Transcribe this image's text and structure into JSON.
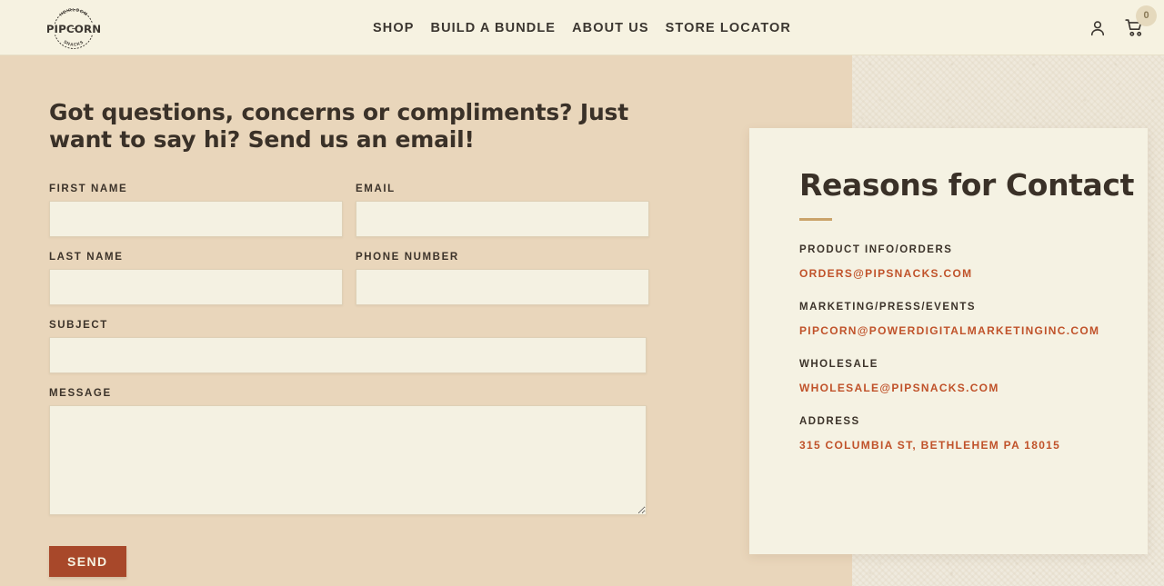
{
  "header": {
    "logo": {
      "brand": "PIPCORN",
      "arc_top": "HEIRLOOM",
      "arc_bottom": "SNACKS",
      "alt": "Pipcorn Heirloom Snacks"
    },
    "nav": [
      {
        "label": "SHOP",
        "name": "nav-shop"
      },
      {
        "label": "BUILD A BUNDLE",
        "name": "nav-build-a-bundle"
      },
      {
        "label": "ABOUT US",
        "name": "nav-about-us"
      },
      {
        "label": "STORE LOCATOR",
        "name": "nav-store-locator"
      }
    ],
    "account_icon": "account-person-icon",
    "cart_icon": "shopping-cart-icon",
    "cart_count": "0"
  },
  "main": {
    "heading": "Got questions, concerns or compliments? Just want to say hi? Send us an email!",
    "form": {
      "first_name": {
        "label": "FIRST NAME",
        "value": "",
        "placeholder": ""
      },
      "last_name": {
        "label": "LAST NAME",
        "value": "",
        "placeholder": ""
      },
      "email": {
        "label": "EMAIL",
        "value": "",
        "placeholder": ""
      },
      "phone": {
        "label": "PHONE NUMBER",
        "value": "",
        "placeholder": ""
      },
      "subject": {
        "label": "SUBJECT",
        "value": "",
        "placeholder": ""
      },
      "message": {
        "label": "MESSAGE",
        "value": "",
        "placeholder": ""
      },
      "send_label": "SEND"
    }
  },
  "reasons": {
    "title": "Reasons for Contact",
    "groups": [
      {
        "label": "PRODUCT INFO/ORDERS",
        "value": "ORDERS@PIPSNACKS.COM"
      },
      {
        "label": "MARKETING/PRESS/EVENTS",
        "value": "PIPCORN@POWERDIGITALMARKETINGINC.COM"
      },
      {
        "label": "WHOLESALE",
        "value": "WHOLESALE@PIPSNACKS.COM"
      },
      {
        "label": "ADDRESS",
        "value": "315 COLUMBIA ST, BETHLEHEM PA 18015"
      }
    ]
  },
  "colors": {
    "page_background": "#e9d6bb",
    "header_background": "#f6f2e1",
    "card_background": "#f5f2e3",
    "input_background": "#f4f1e2",
    "text_dark": "#3a3128",
    "accent_red": "#c0522a",
    "button_red": "#a8482a",
    "rule_tan": "#caa36a",
    "badge_tan": "#e5d9bd"
  }
}
